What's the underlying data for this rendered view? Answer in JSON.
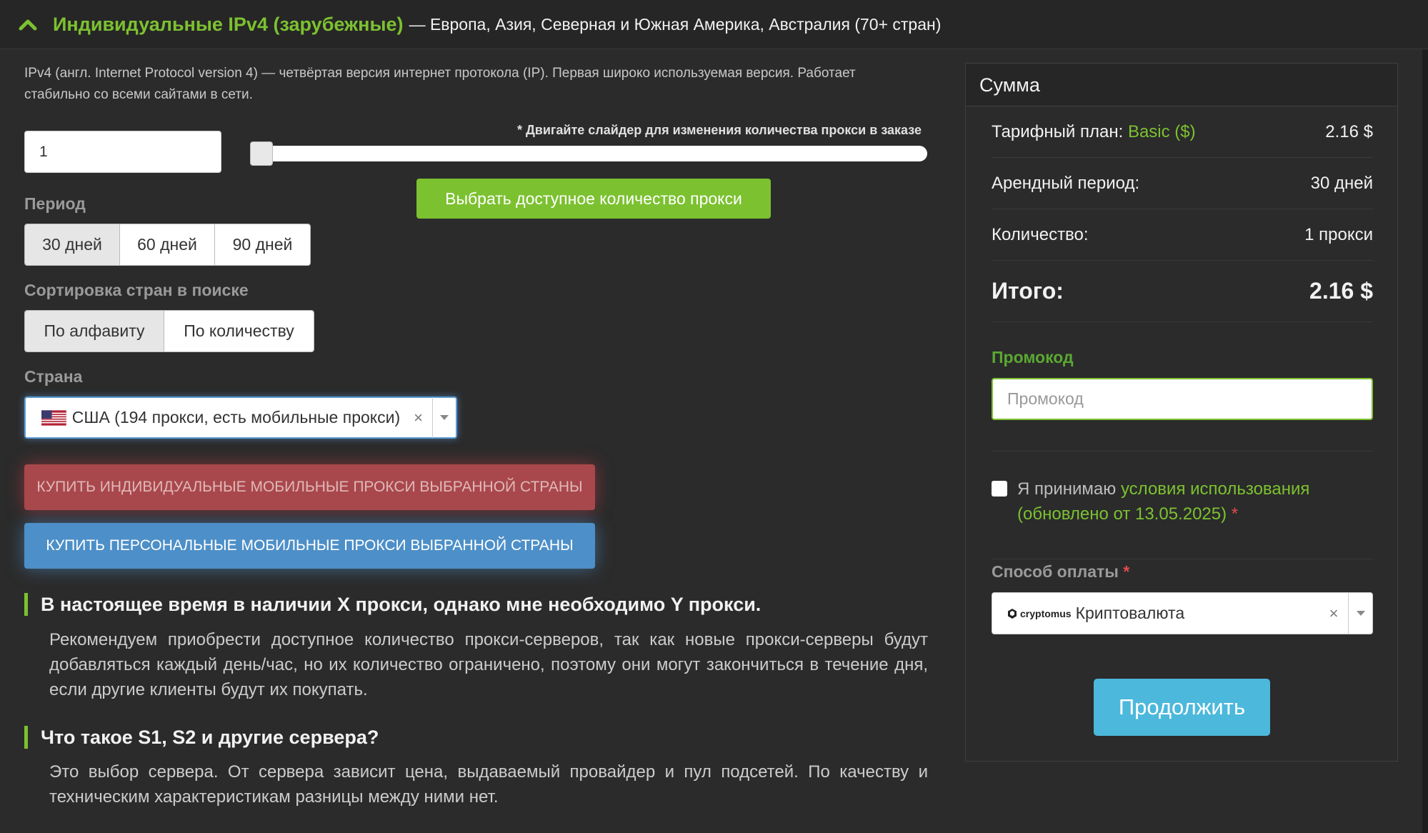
{
  "header": {
    "title": "Индивидуальные IPv4 (зарубежные)",
    "subtitle": "— Европа, Азия, Северная и Южная Америка, Австралия (70+ стран)",
    "collapse_icon": "chevron-up-icon"
  },
  "description": "IPv4 (англ. Internet Protocol version 4) — четвёртая версия интернет протокола (IP). Первая широко используемая версия. Работает стабильно со всеми сайтами в сети.",
  "quantity": {
    "value": "1",
    "slider_hint": "* Двигайте слайдер для изменения количества прокси в заказе",
    "select_available_label": "Выбрать доступное количество прокси"
  },
  "period": {
    "label": "Период",
    "options": [
      "30 дней",
      "60 дней",
      "90 дней"
    ],
    "selected": "30 дней"
  },
  "sorting": {
    "label": "Сортировка стран в поиске",
    "options": [
      "По алфавиту",
      "По количеству"
    ],
    "selected": "По алфавиту"
  },
  "country": {
    "label": "Страна",
    "value": "США (194 прокси, есть мобильные прокси)",
    "flag_icon": "us-flag-icon"
  },
  "buttons": {
    "buy_individual_mobile": "КУПИТЬ ИНДИВИДУАЛЬНЫЕ МОБИЛЬНЫЕ ПРОКСИ ВЫБРАННОЙ СТРАНЫ",
    "buy_personal_mobile": "КУПИТЬ ПЕРСОНАЛЬНЫЕ МОБИЛЬНЫЕ ПРОКСИ ВЫБРАННОЙ СТРАНЫ"
  },
  "faq": [
    {
      "question": "В настоящее время в наличии X прокси, однако мне необходимо Y прокси.",
      "answer": "Рекомендуем приобрести доступное количество прокси-серверов, так как новые прокси-серверы будут добавляться каждый день/час, но их количество ограничено, поэтому они могут закончиться в течение дня, если другие клиенты будут их покупать."
    },
    {
      "question": "Что такое S1, S2 и другие сервера?",
      "answer": "Это выбор сервера. От сервера зависит цена, выдаваемый провайдер и пул подсетей. По качеству и техническим характеристикам разницы между ними нет."
    }
  ],
  "summary": {
    "title": "Сумма",
    "plan_label": "Тарифный план:",
    "plan_name": "Basic ($)",
    "plan_price": "2.16 $",
    "period_label": "Арендный период:",
    "period_value": "30 дней",
    "qty_label": "Количество:",
    "qty_value": "1 прокси",
    "total_label": "Итого:",
    "total_value": "2.16 $",
    "promo_label": "Промокод",
    "promo_placeholder": "Промокод",
    "terms_prefix": "Я принимаю",
    "terms_link": "условия использования (обновлено от 13.05.2025)",
    "required_mark": "*",
    "payment_label": "Способ оплаты",
    "payment_logo_text": "cryptomus",
    "payment_value": "Криптовалюта",
    "continue_label": "Продолжить"
  },
  "colors": {
    "accent_green": "#7cc130",
    "background": "#2b2b2b",
    "red_button": "#a9484c",
    "blue_button": "#4d8fc8",
    "continue_button": "#4cb8dc"
  }
}
